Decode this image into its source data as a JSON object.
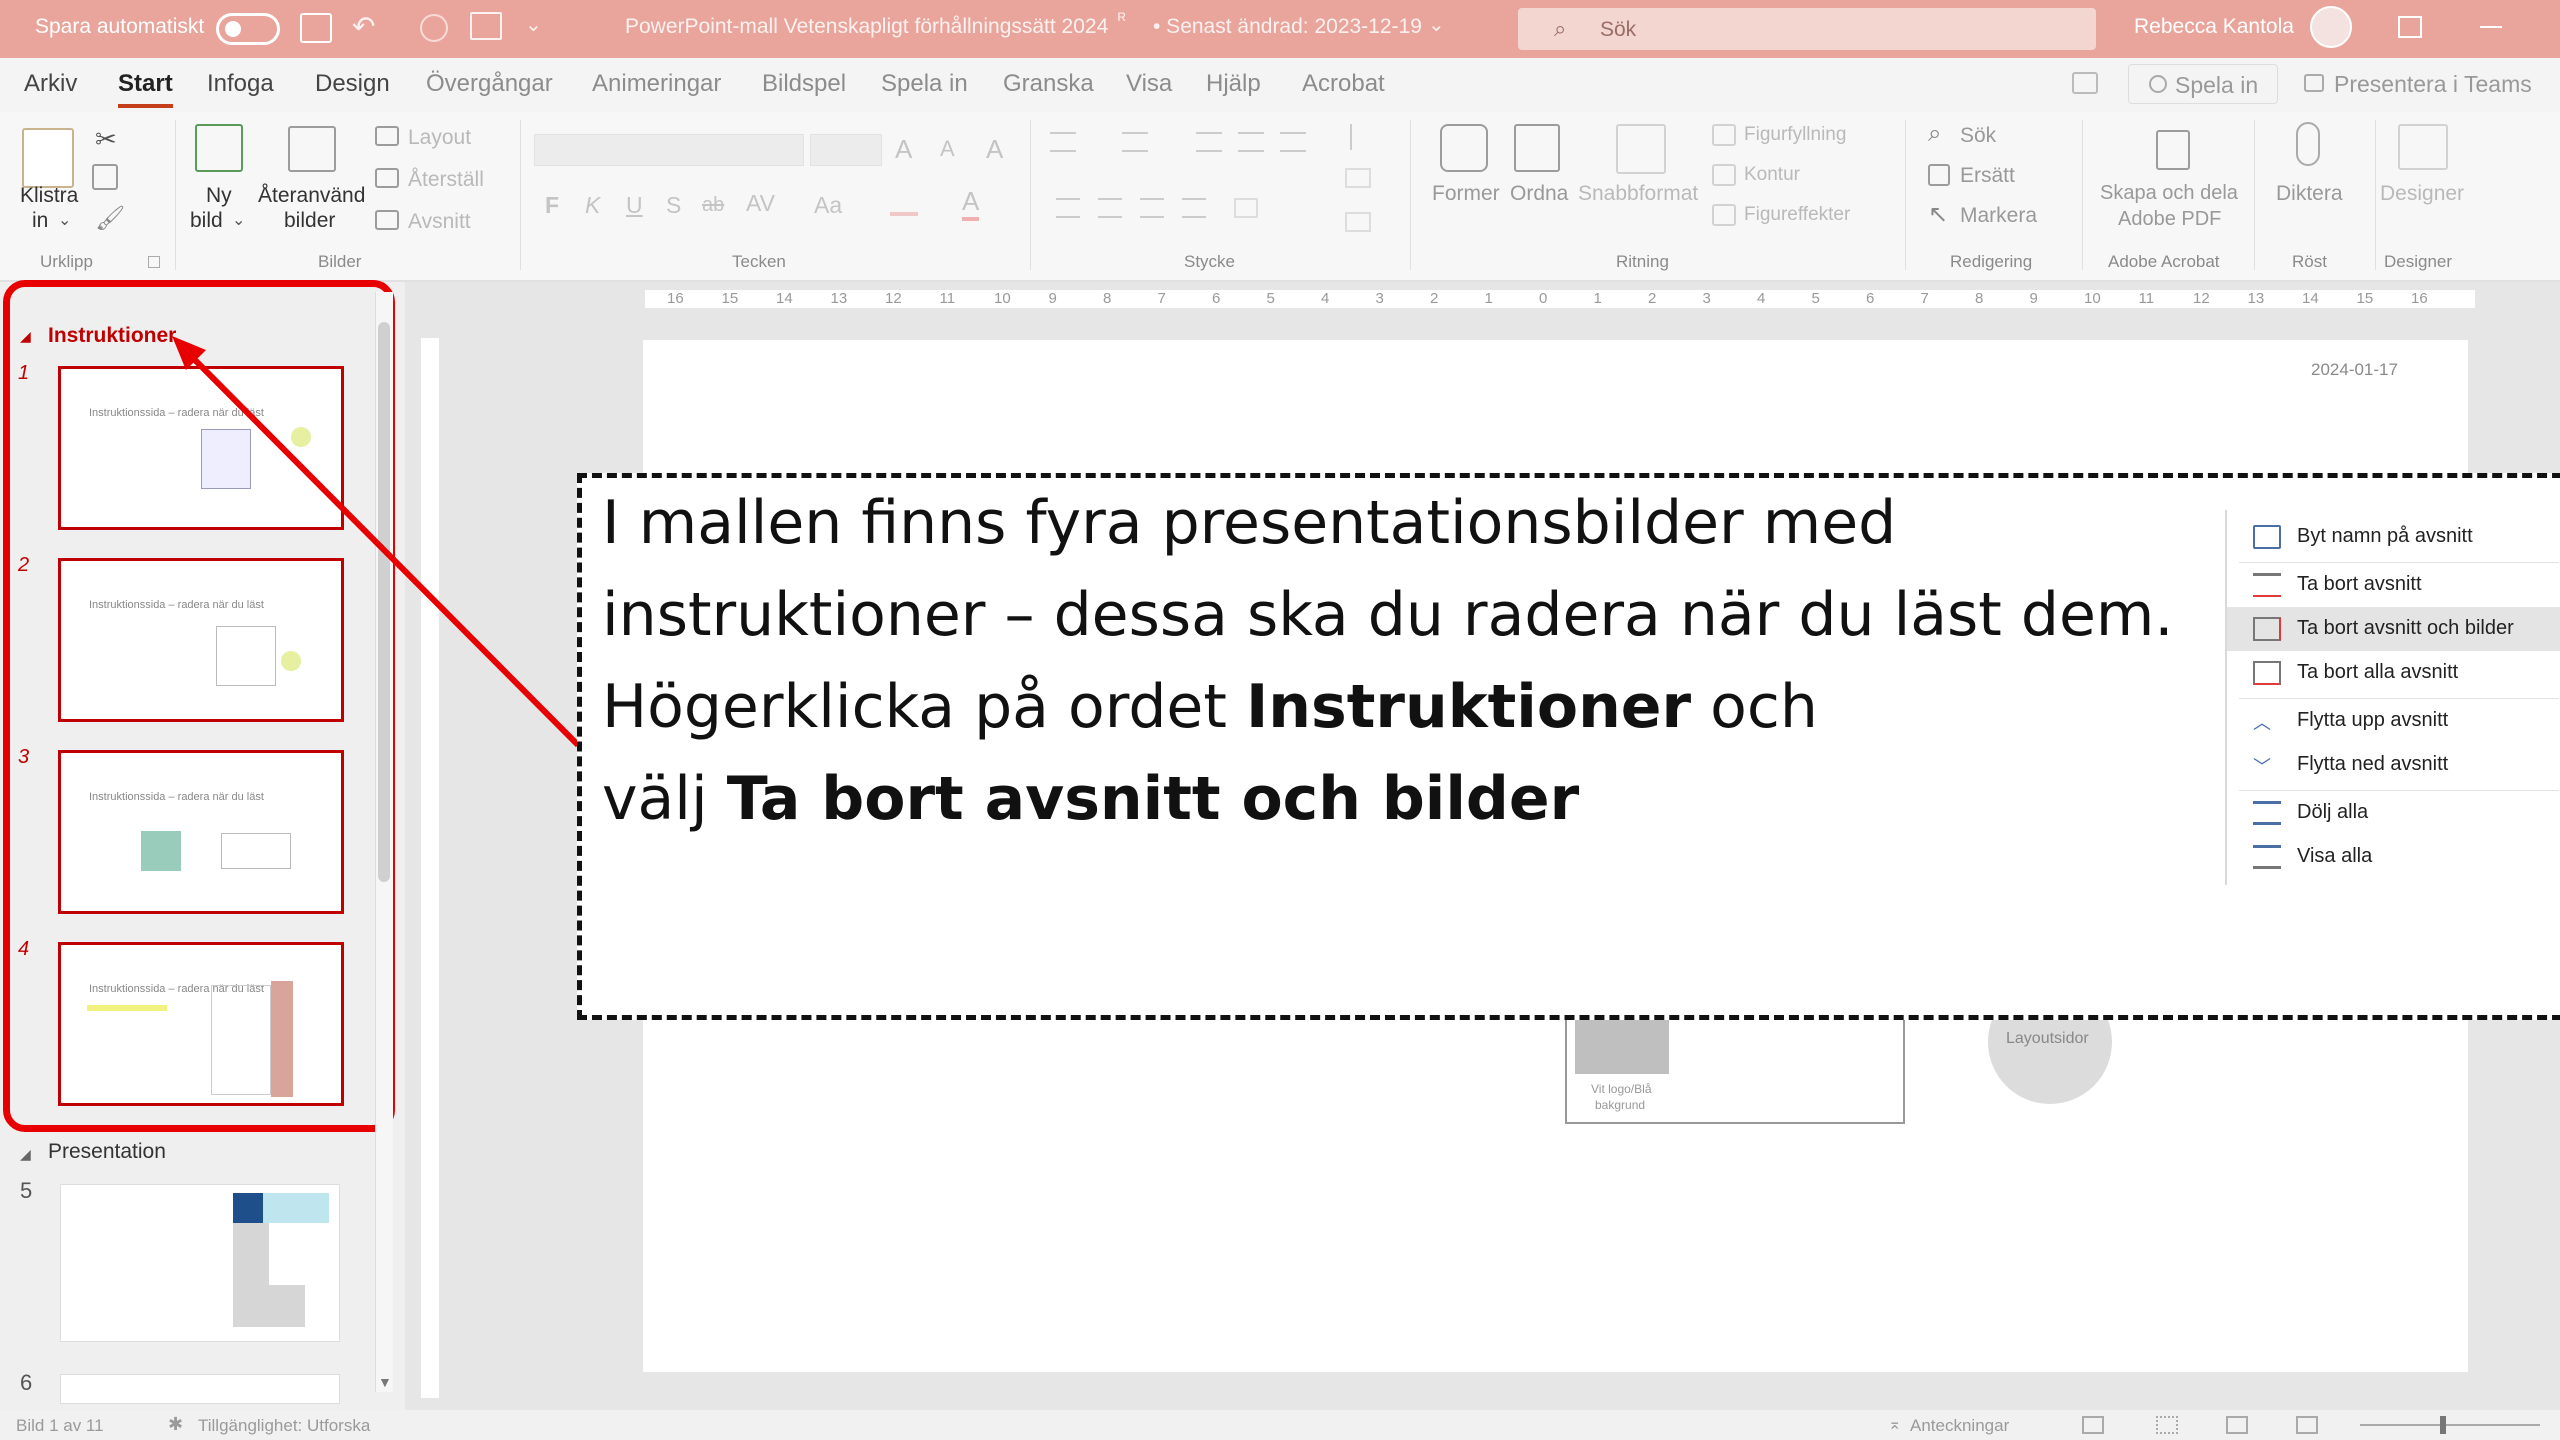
{
  "titlebar": {
    "autosave_label": "Spara automatiskt",
    "doc_title": "PowerPoint-mall Vetenskapligt förhållningssätt 2024",
    "last_saved": "• Senast ändrad: 2023-12-19",
    "search_placeholder": "Sök",
    "user_name": "Rebecca Kantola"
  },
  "tabs": [
    "Arkiv",
    "Start",
    "Infoga",
    "Design",
    "Övergångar",
    "Animeringar",
    "Bildspel",
    "Spela in",
    "Granska",
    "Visa",
    "Hjälp",
    "Acrobat"
  ],
  "tab_right": {
    "spela_in": "Spela in",
    "presentera": "Presentera i Teams"
  },
  "ribbon": {
    "klistra_1": "Klistra",
    "klistra_2": "in",
    "urklipp": "Urklipp",
    "ny_1": "Ny",
    "ny_2": "bild",
    "ateranvand_1": "Återanvänd",
    "ateranvand_2": "bilder",
    "layout": "Layout",
    "aterstall": "Återställ",
    "avsnitt": "Avsnitt",
    "bilder": "Bilder",
    "tecken": "Tecken",
    "stycke": "Stycke",
    "former": "Former",
    "ordna": "Ordna",
    "snabbformat": "Snabbformat",
    "figurfyllning": "Figurfyllning",
    "kontur": "Kontur",
    "figureffekter": "Figureffekter",
    "ritning": "Ritning",
    "sok": "Sök",
    "ersatt": "Ersätt",
    "markera": "Markera",
    "redigering": "Redigering",
    "skapa_1": "Skapa och dela",
    "skapa_2": "Adobe PDF",
    "adobe_acrobat": "Adobe Acrobat",
    "diktera": "Diktera",
    "rost": "Röst",
    "designer": "Designer",
    "designer_group": "Designer",
    "font_btns": [
      "F",
      "K",
      "U",
      "S",
      "ab",
      "AV",
      "Aa",
      "A"
    ]
  },
  "ruler": {
    "labels": [
      "16",
      "15",
      "14",
      "13",
      "12",
      "11",
      "10",
      "9",
      "8",
      "7",
      "6",
      "5",
      "4",
      "3",
      "2",
      "1",
      "0",
      "1",
      "2",
      "3",
      "4",
      "5",
      "6",
      "7",
      "8",
      "9",
      "10",
      "11",
      "12",
      "13",
      "14",
      "15",
      "16"
    ]
  },
  "left_pane": {
    "section1": "Instruktioner",
    "section2": "Presentation",
    "thumb_title": "Instruktionssida – radera när du läst",
    "numbers": [
      "1",
      "2",
      "3",
      "4",
      "5",
      "6"
    ]
  },
  "slide": {
    "date": "2024-01-17",
    "layout_bubble": "Layoutsidor",
    "logo_caption_1": "Vit logo/Blå",
    "logo_caption_2": "bakgrund"
  },
  "callout": {
    "line1": "I mallen finns fyra presentationsbilder med",
    "line2": "instruktioner – dessa ska du radera när du läst dem.",
    "line3_a": "Högerklicka på ordet",
    "line3_b": "Instruktioner",
    "line3_c": "och",
    "line4_a": "välj",
    "line4_b": "Ta bort avsnitt och bilder"
  },
  "context_menu": [
    {
      "label": "Byt namn på avsnitt",
      "icon": "rename-section-icon"
    },
    {
      "label": "Ta bort avsnitt",
      "icon": "remove-section-icon"
    },
    {
      "label": "Ta bort avsnitt och bilder",
      "icon": "remove-section-slides-icon"
    },
    {
      "label": "Ta bort alla avsnitt",
      "icon": "remove-all-sections-icon"
    },
    {
      "label": "Flytta upp avsnitt",
      "icon": "chevron-up-icon"
    },
    {
      "label": "Flytta ned avsnitt",
      "icon": "chevron-down-icon"
    },
    {
      "label": "Dölj alla",
      "icon": "collapse-all-icon"
    },
    {
      "label": "Visa alla",
      "icon": "expand-all-icon"
    }
  ],
  "statusbar": {
    "slide_count": "Bild 1 av 11",
    "accessibility": "Tillgänglighet: Utforska",
    "notes": "Anteckningar"
  },
  "colors": {
    "titlebar": "#e9a59b",
    "accent_red": "#c00000",
    "ppt_orange": "#c43e1c"
  }
}
